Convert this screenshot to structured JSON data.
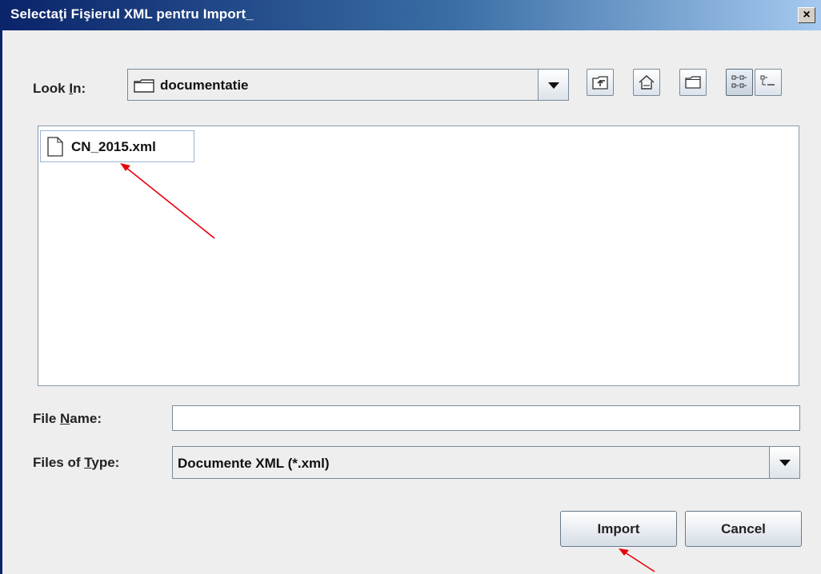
{
  "dialog": {
    "title": "Selectaţi Fişierul XML pentru Import_",
    "close_symbol": "×"
  },
  "look_in": {
    "label": "Look In:",
    "mnemonic": "I",
    "value": "documentatie"
  },
  "toolbar": {
    "icons": [
      "up-one-level-icon",
      "home-icon",
      "new-folder-icon",
      "list-view-icon",
      "details-view-icon"
    ]
  },
  "files": [
    {
      "name": "CN_2015.xml",
      "icon": "file-icon"
    }
  ],
  "file_name": {
    "label": "File Name:",
    "value": ""
  },
  "files_of_type": {
    "label": "Files of Type:",
    "value": "Documente XML (*.xml)"
  },
  "buttons": {
    "import": "Import",
    "cancel": "Cancel"
  },
  "annotations": {
    "arrow_color": "#e8000b"
  }
}
